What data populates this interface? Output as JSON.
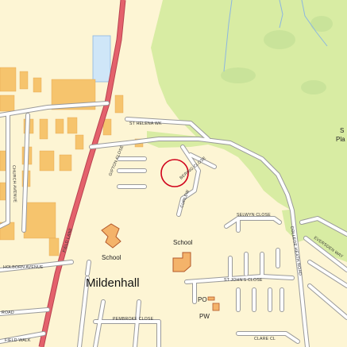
{
  "map": {
    "place_name": "Mildenhall",
    "colors": {
      "background": "#fdf5d4",
      "green": "#d8eca3",
      "building": "#f6c46d",
      "building_outline": "#e0a24c",
      "road_casing": "#9a9a9a",
      "road_fill": "#ffffff",
      "a_road": "#e4616c",
      "a_road_casing": "#b84350",
      "water": "#cfe6f8",
      "water_line": "#8cb6e0",
      "poi_fill": "#f4b36a",
      "poi_outline": "#b3592b",
      "marker": "#d0021b"
    },
    "street_labels": [
      "ST HELENA WK",
      "GIPTON CLOSE",
      "BERING CLOSE",
      "CURLEW",
      "SELWYN CLOSE",
      "EVERSDEN WAY",
      "COLLEGE HEATH ROAD",
      "ST JOHN'S CLOSE",
      "CHURCH AVENUE",
      "FIELD LANE",
      "HOLBORN AVENUE",
      "PEMBROKE CLOSE",
      "FIELD WALK",
      "CLARE CL",
      "ROAD"
    ],
    "poi_labels": {
      "school_west": "School",
      "school_east": "School",
      "post_office": "PO",
      "place_of_worship": "PW"
    },
    "partial_labels": {
      "edge_top": "S",
      "edge_bottom": "Pla"
    },
    "marker_icon": "location-circle-icon"
  }
}
